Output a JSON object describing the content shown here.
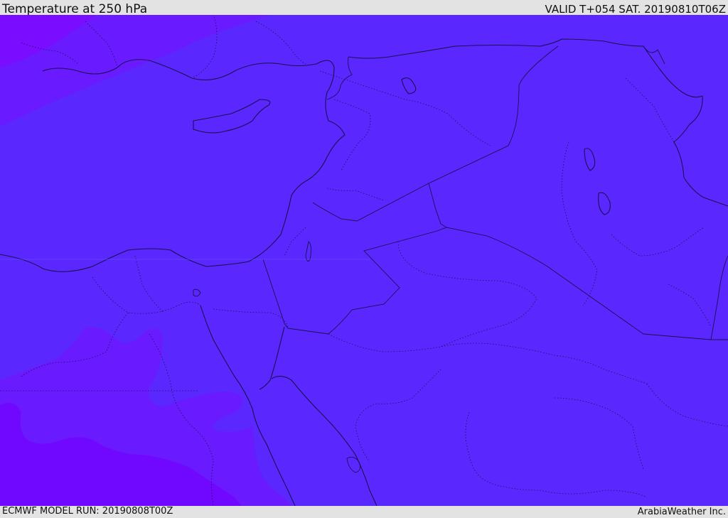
{
  "header": {
    "title": "Temperature at 250 hPa",
    "valid_time": "VALID T+054 SAT. 20190810T06Z"
  },
  "footer": {
    "model_run": "ECMWF MODEL RUN: 20190808T00Z",
    "credit": "ArabiaWeather Inc."
  },
  "colors": {
    "frame_background": "#e3e3e3",
    "field_main": "#5a28ff",
    "field_cooler_band": "#6a1aff",
    "field_coldest": "#8000ff",
    "coastline_border": "#1a1050"
  }
}
